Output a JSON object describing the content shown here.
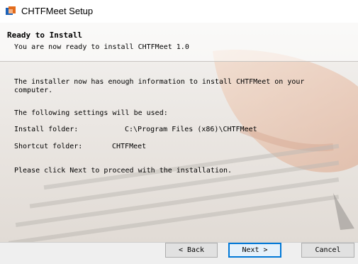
{
  "window": {
    "title": "CHTFMeet Setup"
  },
  "header": {
    "title": "Ready to Install",
    "subtitle": "You are now ready to install CHTFMeet 1.0"
  },
  "body": {
    "intro_line1": "The installer now has enough information to install CHTFMeet on your",
    "intro_line2": "computer.",
    "settings_heading": "The following settings will be used:",
    "install_folder_label": "Install folder:",
    "install_folder_value": "C:\\Program Files (x86)\\CHTFMeet",
    "shortcut_folder_label": "Shortcut folder:",
    "shortcut_folder_value": "CHTFMeet",
    "proceed_text": "Please click Next to proceed with the installation."
  },
  "buttons": {
    "back": "< Back",
    "next": "Next >",
    "cancel": "Cancel"
  }
}
